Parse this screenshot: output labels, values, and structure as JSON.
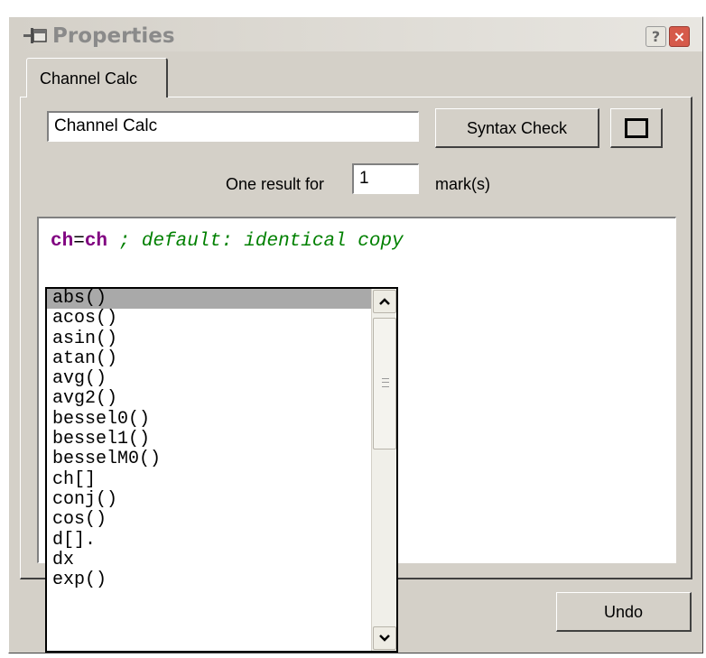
{
  "window": {
    "title": "Properties",
    "help_label": "?",
    "close_label": "×"
  },
  "tabs": [
    {
      "label": "Channel Calc",
      "selected": true
    }
  ],
  "form": {
    "name_value": "Channel Calc",
    "syntax_check_label": "Syntax Check",
    "one_result_label": "One result for",
    "marks_value": "1",
    "marks_label": "mark(s)"
  },
  "editor": {
    "line1": {
      "left": "ch",
      "equals": "=",
      "right": "ch",
      "comment": " ; default: identical copy"
    }
  },
  "undo_label": "Undo",
  "autocomplete": {
    "selected_index": 0,
    "items": [
      "abs()",
      "acos()",
      "asin()",
      "atan()",
      "avg()",
      "avg2()",
      "bessel0()",
      "bessel1()",
      "besselM0()",
      "ch[]",
      "conj()",
      "cos()",
      "d[].",
      "dx",
      "exp()"
    ]
  },
  "colors": {
    "keyword": "#800080",
    "comment": "#008000",
    "selection": "#a9a9a9"
  }
}
